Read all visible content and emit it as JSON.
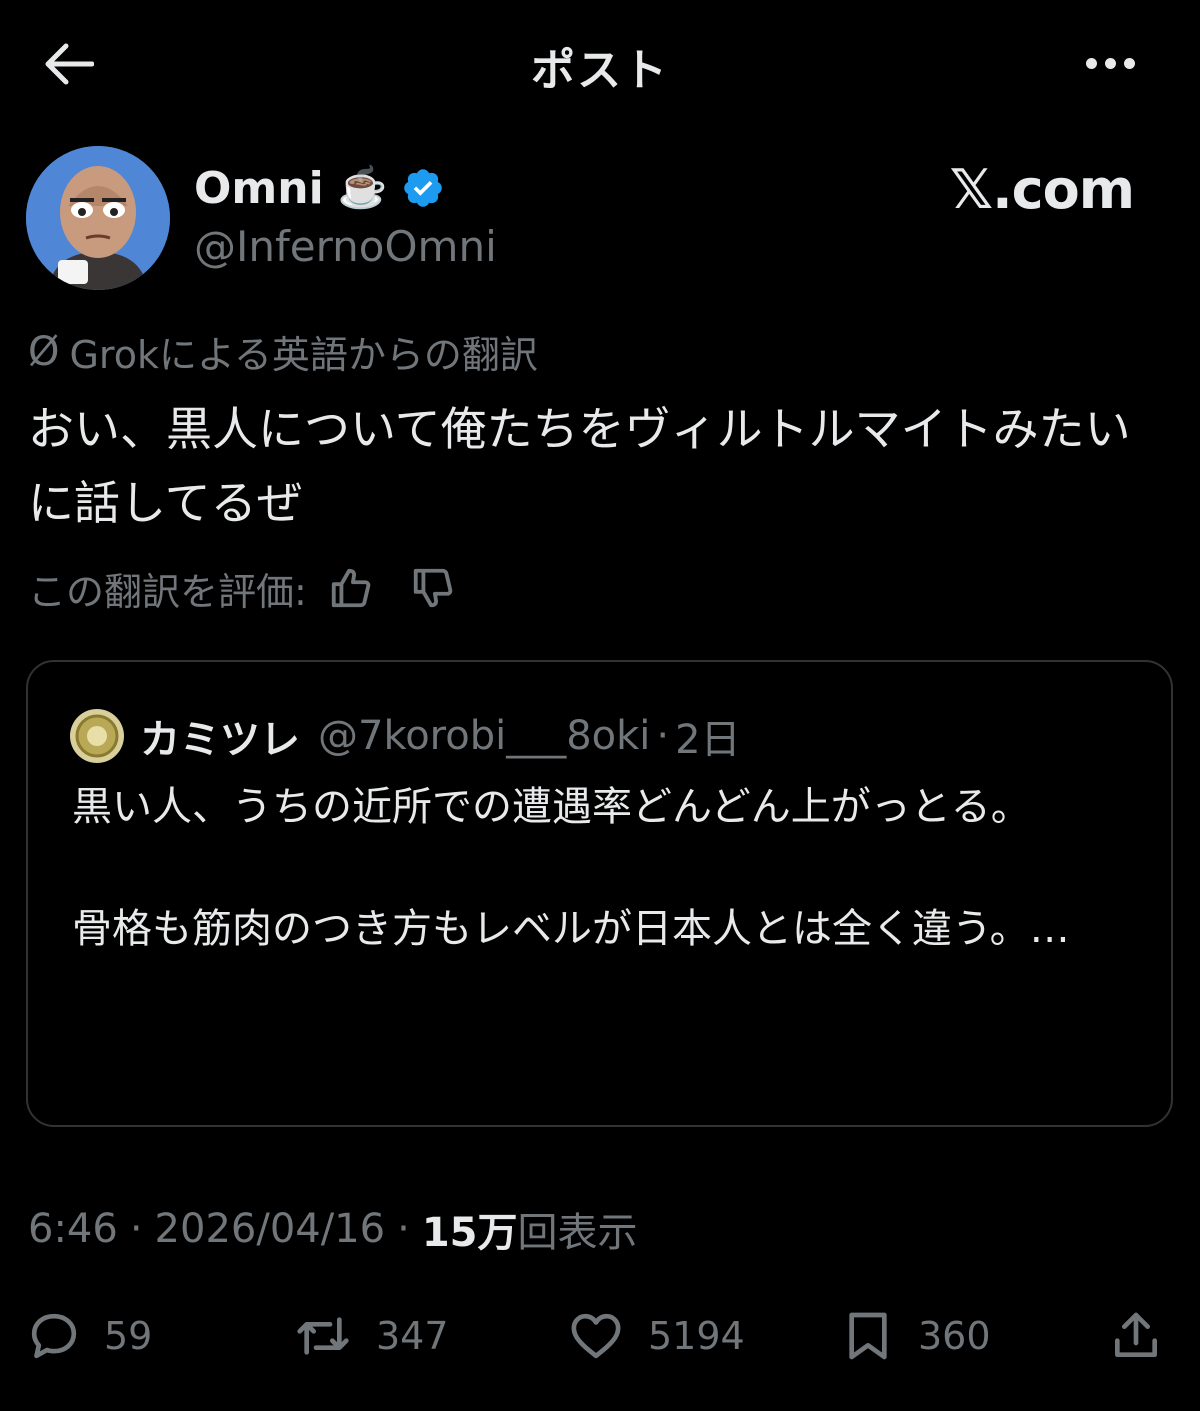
{
  "header": {
    "title": "ポスト",
    "back_icon": "arrow-left-icon",
    "more_icon": "more-horizontal-icon"
  },
  "author": {
    "name": "Omni",
    "emoji": "☕️",
    "verified_icon": "verified-badge-icon",
    "handle": "@InfernoOmni",
    "brand": "𝕏.com"
  },
  "translation": {
    "label": "Grokによる英語からの翻訳",
    "icon": "grok-icon",
    "text": "おい、黒人について俺たちをヴィルトルマイトみたいに話してるぜ",
    "rate_label": "この翻訳を評価:",
    "thumbs_up_icon": "thumbs-up-icon",
    "thumbs_down_icon": "thumbs-down-icon"
  },
  "quote": {
    "name": "カミツレ",
    "handle": "@7korobi___8oki",
    "separator": "·",
    "time": "2日",
    "paragraph1": "黒い人、うちの近所での遭遇率どんどん上がっとる。",
    "paragraph2": "骨格も筋肉のつき方もレベルが日本人とは全く違う。…"
  },
  "meta": {
    "time": "6:46",
    "sep": "·",
    "date": "2026/04/16",
    "views_num": "15万",
    "views_label": "回表示"
  },
  "actions": {
    "reply": "59",
    "retweet": "347",
    "like": "5194",
    "bookmark": "360"
  },
  "colors": {
    "background": "#000000",
    "text": "#e7e9ea",
    "muted": "#71767b",
    "border": "#2f3336",
    "verified": "#1d9bf0"
  }
}
